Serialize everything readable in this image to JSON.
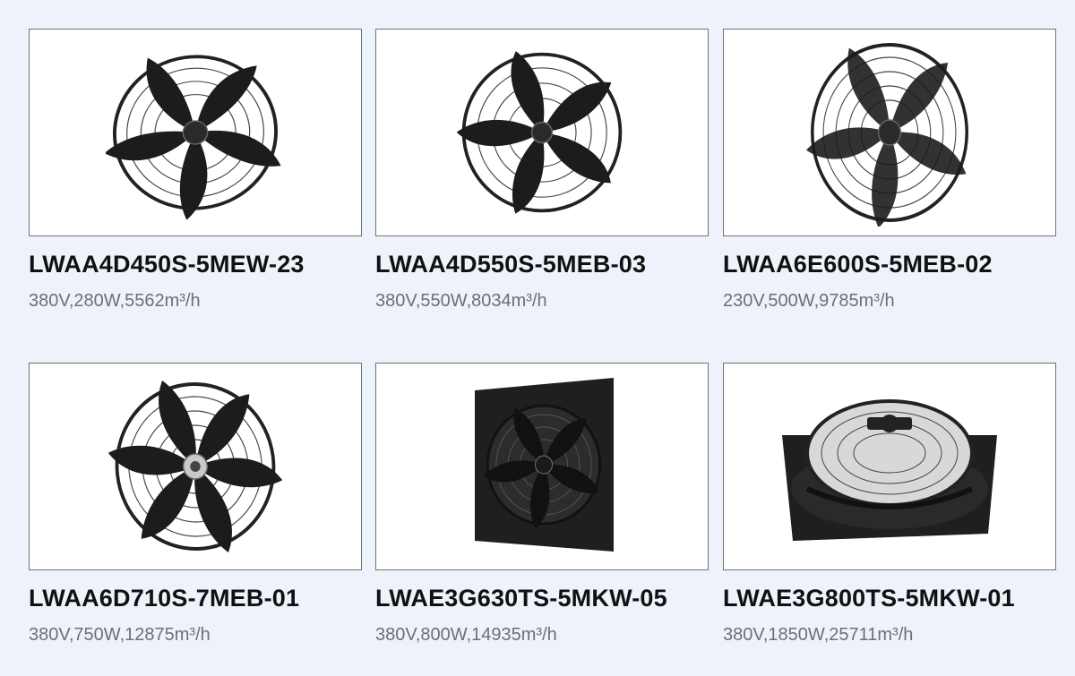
{
  "products": [
    {
      "name": "LWAA4D450S-5MEW-23",
      "specs": "380V,280W,5562m³/h",
      "image": "axial-fan-icon"
    },
    {
      "name": "LWAA4D550S-5MEB-03",
      "specs": "380V,550W,8034m³/h",
      "image": "axial-fan-icon"
    },
    {
      "name": "LWAA6E600S-5MEB-02",
      "specs": "230V,500W,9785m³/h",
      "image": "axial-fan-icon"
    },
    {
      "name": "LWAA6D710S-7MEB-01",
      "specs": "380V,750W,12875m³/h",
      "image": "axial-fan-icon"
    },
    {
      "name": "LWAE3G630TS-5MKW-05",
      "specs": "380V,800W,14935m³/h",
      "image": "square-plate-fan-icon"
    },
    {
      "name": "LWAE3G800TS-5MKW-01",
      "specs": "380V,1850W,25711m³/h",
      "image": "wall-plate-fan-icon"
    }
  ],
  "colors": {
    "background": "#eef3fb",
    "card_border": "#6f6f6f",
    "title": "#111111",
    "specs": "#6f6f6f",
    "fan": "#1c1c1c"
  }
}
